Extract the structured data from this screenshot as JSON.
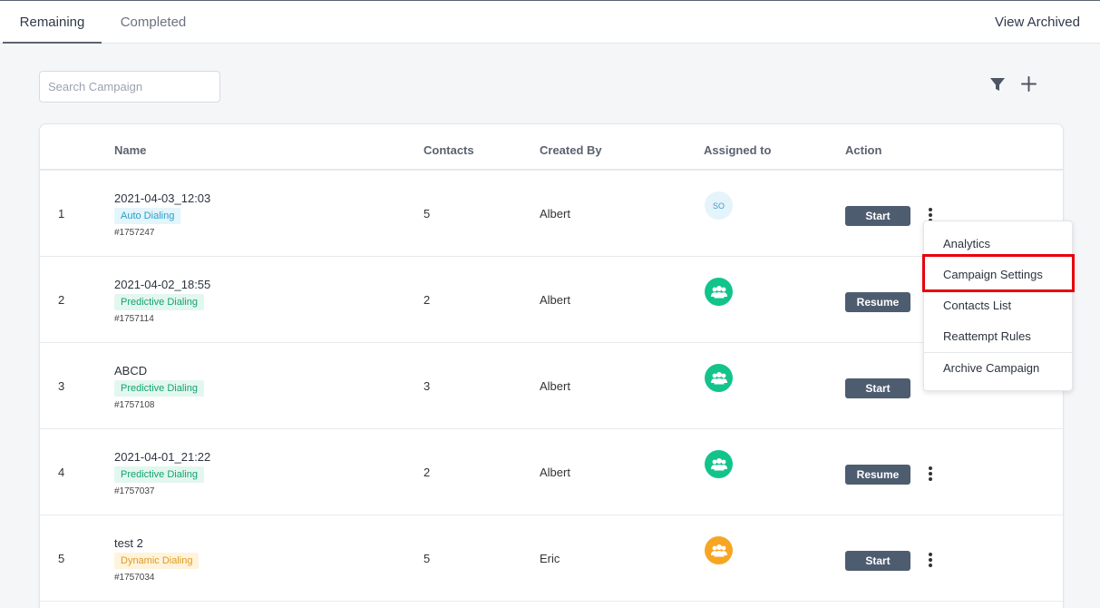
{
  "tabs": [
    {
      "label": "Remaining",
      "active": true
    },
    {
      "label": "Completed",
      "active": false
    }
  ],
  "view_archived_label": "View Archived",
  "search": {
    "placeholder": "Search Campaign",
    "value": ""
  },
  "toolbar": {
    "filter_icon": "filter-icon",
    "add_icon": "plus-icon"
  },
  "table": {
    "columns": [
      "",
      "Name",
      "Contacts",
      "Created By",
      "Assigned to",
      "Action"
    ],
    "rows": [
      {
        "index": "1",
        "name": "2021-04-03_12:03",
        "tag": "Auto Dialing",
        "id": "#1757247",
        "contacts": "5",
        "created_by": "Albert",
        "assigned": "SO",
        "action": "Start"
      },
      {
        "index": "2",
        "name": "2021-04-02_18:55",
        "tag": "Predictive Dialing",
        "id": "#1757114",
        "contacts": "2",
        "created_by": "Albert",
        "assigned": "group-icon",
        "action": "Resume"
      },
      {
        "index": "3",
        "name": "ABCD",
        "tag": "Predictive Dialing",
        "id": "#1757108",
        "contacts": "3",
        "created_by": "Albert",
        "assigned": "group-icon",
        "action": "Start"
      },
      {
        "index": "4",
        "name": "2021-04-01_21:22",
        "tag": "Predictive Dialing",
        "id": "#1757037",
        "contacts": "2",
        "created_by": "Albert",
        "assigned": "group-icon",
        "action": "Resume"
      },
      {
        "index": "5",
        "name": "test 2",
        "tag": "Dynamic Dialing",
        "id": "#1757034",
        "contacts": "5",
        "created_by": "Eric",
        "assigned": "group-icon",
        "action": "Start"
      }
    ]
  },
  "menu": {
    "items": [
      "Analytics",
      "Campaign Settings",
      "Contacts List",
      "Reattempt Rules",
      "Archive Campaign"
    ],
    "highlighted": "Campaign Settings"
  },
  "colors": {
    "primary_button": "#4e5c70",
    "auto_tag": "#2b9ec9",
    "predictive_tag": "#14a36f",
    "dynamic_tag": "#e09a1c",
    "avatar_green": "#12c48b",
    "avatar_orange": "#f7a623",
    "highlight": "#e8000b"
  }
}
